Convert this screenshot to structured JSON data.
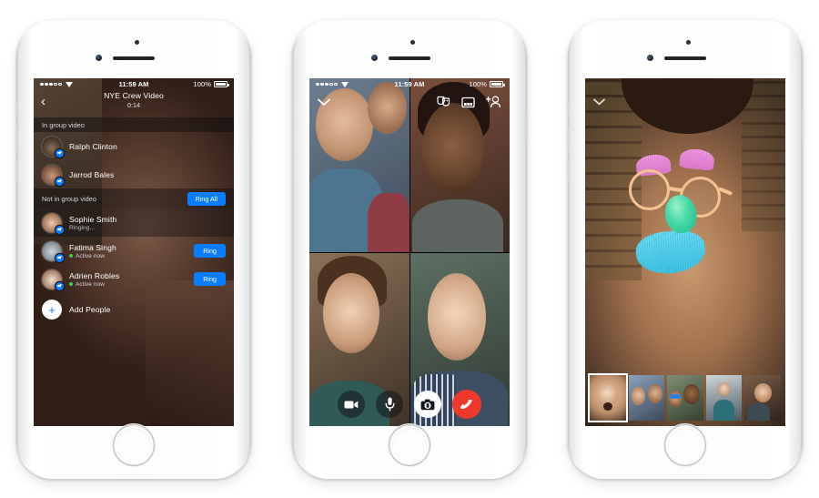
{
  "scene": {
    "title": "Facebook Messenger group video calling — three iPhone screens"
  },
  "status_bar": {
    "time": "11:59 AM",
    "battery_label": "100%",
    "signal_icon": "signal-dots-icon",
    "wifi_icon": "wifi-icon",
    "battery_icon": "battery-icon"
  },
  "phone1": {
    "nav": {
      "back_icon": "chevron-left-icon",
      "title": "NYE Crew Video",
      "duration": "0:14"
    },
    "section_in": {
      "label": "In group video"
    },
    "section_not_in": {
      "label": "Not in group video",
      "ring_all_label": "Ring All"
    },
    "in_call": [
      {
        "name": "Ralph Clinton",
        "avatar": "avatar-ralph",
        "badge": "messenger-badge-icon"
      },
      {
        "name": "Jarrod Bales",
        "avatar": "avatar-jarrod",
        "badge": "messenger-badge-icon"
      }
    ],
    "not_in_call": [
      {
        "name": "Sophie Smith",
        "status": "Ringing...",
        "status_type": "ringing",
        "action": null,
        "avatar": "avatar-sophie"
      },
      {
        "name": "Fatima Singh",
        "status": "Active now",
        "status_type": "active",
        "action": "Ring",
        "avatar": "avatar-fatima"
      },
      {
        "name": "Adrien Robles",
        "status": "Active now",
        "status_type": "active",
        "action": "Ring",
        "avatar": "avatar-adrien"
      }
    ],
    "add_people": {
      "label": "Add People",
      "icon": "plus-icon"
    }
  },
  "phone2": {
    "top_bar": {
      "minimize_icon": "chevron-down-icon",
      "masks_icon": "masks-effects-icon",
      "layout_icon": "grid-layout-icon",
      "add_person_icon": "add-person-icon"
    },
    "grid_tiles": [
      {
        "id": "tile-top-left",
        "label": "participant-1"
      },
      {
        "id": "tile-top-right",
        "label": "participant-2"
      },
      {
        "id": "tile-bottom-left",
        "label": "participant-3"
      },
      {
        "id": "tile-bottom-right",
        "label": "participant-4"
      }
    ],
    "controls": [
      {
        "id": "video-toggle",
        "icon": "video-camera-icon",
        "style": "dark"
      },
      {
        "id": "mute-toggle",
        "icon": "microphone-icon",
        "style": "dark"
      },
      {
        "id": "flip-camera",
        "icon": "camera-flip-icon",
        "style": "light"
      },
      {
        "id": "end-call",
        "icon": "end-call-icon",
        "style": "red"
      }
    ]
  },
  "phone3": {
    "minimize_icon": "chevron-down-icon",
    "mask": {
      "name": "furry-glasses-mask",
      "parts": [
        "pink-furry-eyebrows",
        "round-tan-glasses",
        "teal-nose",
        "cyan-furry-mustache"
      ]
    },
    "filmstrip": [
      {
        "id": "thumb-1",
        "selected": true,
        "label": "participant-self"
      },
      {
        "id": "thumb-2",
        "selected": false,
        "label": "participant-pair"
      },
      {
        "id": "thumb-3",
        "selected": false,
        "label": "participant-shades"
      },
      {
        "id": "thumb-4",
        "selected": false,
        "label": "participant-teal"
      },
      {
        "id": "thumb-5",
        "selected": false,
        "label": "participant-five"
      }
    ]
  },
  "colors": {
    "accent_blue": "#0a7cff",
    "end_call_red": "#f0392b",
    "active_green": "#3fcc4a",
    "screen_black": "#000000",
    "page_background": "#ffffff"
  }
}
